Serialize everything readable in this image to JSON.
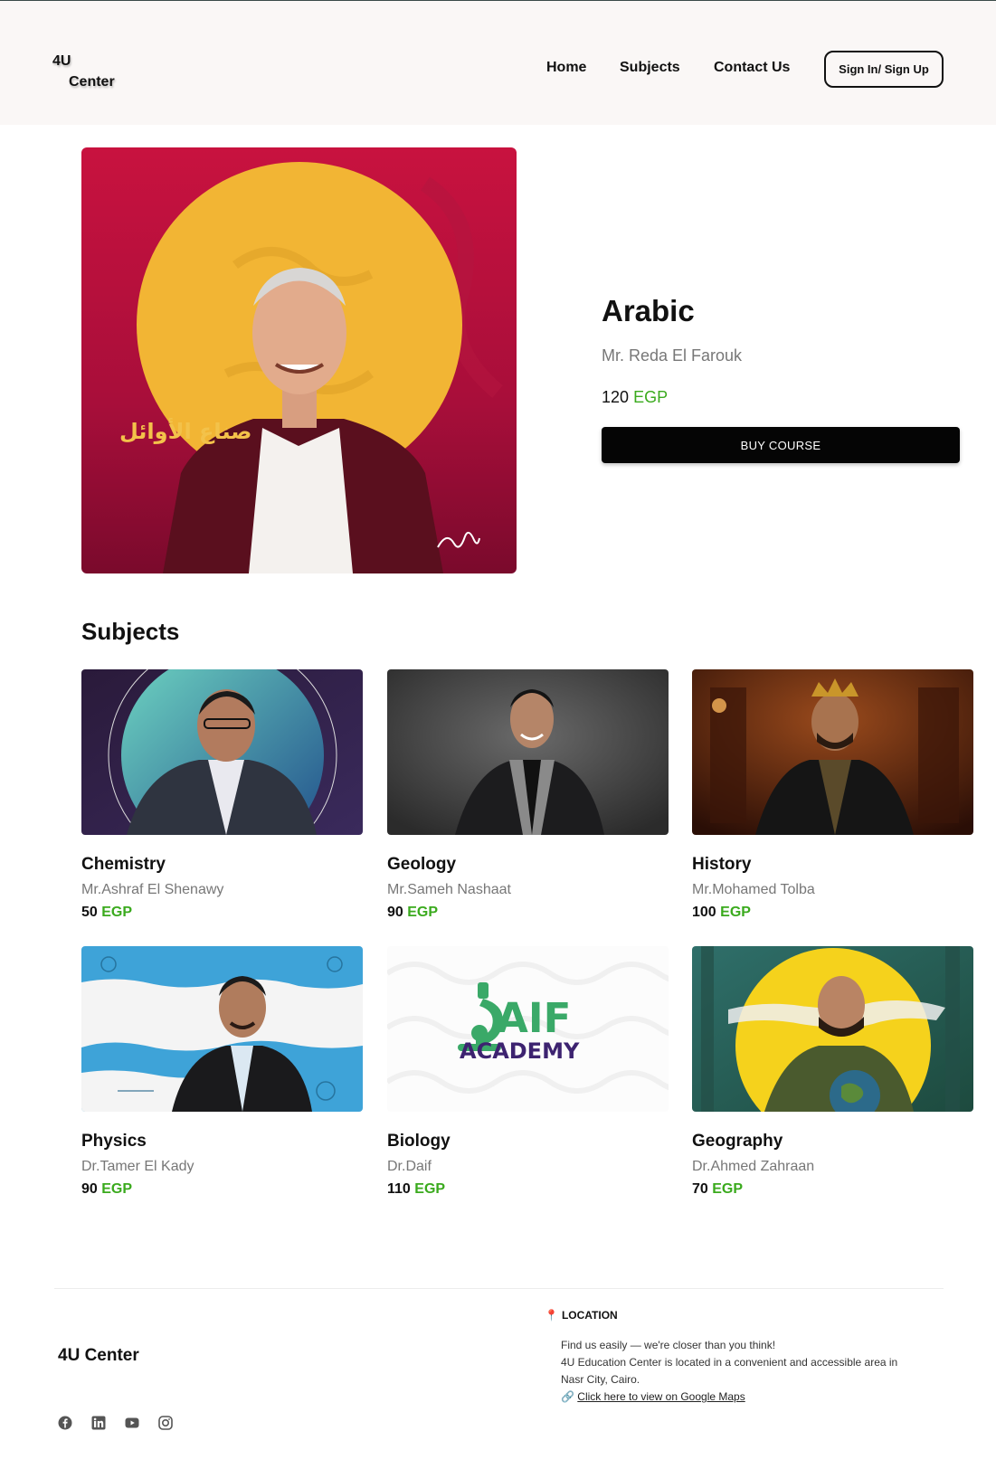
{
  "header": {
    "logo_line1": "4U",
    "logo_line2": "Center",
    "nav": [
      "Home",
      "Subjects",
      "Contact Us"
    ],
    "signin_label": "Sign In/ Sign Up"
  },
  "hero": {
    "title": "Arabic",
    "teacher": "Mr. Reda El Farouk",
    "price_value": "120",
    "currency": "EGP",
    "buy_label": "BUY COURSE",
    "image_text": "صناع الأوائل"
  },
  "subjects": {
    "title": "Subjects",
    "items": [
      {
        "name": "Chemistry",
        "teacher": "Mr.Ashraf El Shenawy",
        "price": "50",
        "currency": "EGP"
      },
      {
        "name": "Geology",
        "teacher": "Mr.Sameh Nashaat",
        "price": "90",
        "currency": "EGP"
      },
      {
        "name": "History",
        "teacher": "Mr.Mohamed Tolba",
        "price": "100",
        "currency": "EGP"
      },
      {
        "name": "Physics",
        "teacher": "Dr.Tamer El Kady",
        "price": "90",
        "currency": "EGP"
      },
      {
        "name": "Biology",
        "teacher": "Dr.Daif",
        "price": "110",
        "currency": "EGP"
      },
      {
        "name": "Geography",
        "teacher": "Dr.Ahmed Zahraan",
        "price": "70",
        "currency": "EGP"
      }
    ],
    "biology_logo_line1": "AIF",
    "biology_logo_line2": "ACADEMY"
  },
  "footer": {
    "brand": "4U Center",
    "location_heading": "LOCATION",
    "location_line1": "Find us easily — we're closer than you think!",
    "location_line2": "4U Education Center is located in a convenient and accessible area in Nasr City, Cairo.",
    "location_link": "Click here to view on Google Maps",
    "social_icons": [
      "facebook-icon",
      "linkedin-icon",
      "youtube-icon",
      "instagram-icon"
    ]
  },
  "colors": {
    "accent_green": "#3aaa1d",
    "header_bg": "#faf7f6",
    "button_black": "#050505"
  }
}
